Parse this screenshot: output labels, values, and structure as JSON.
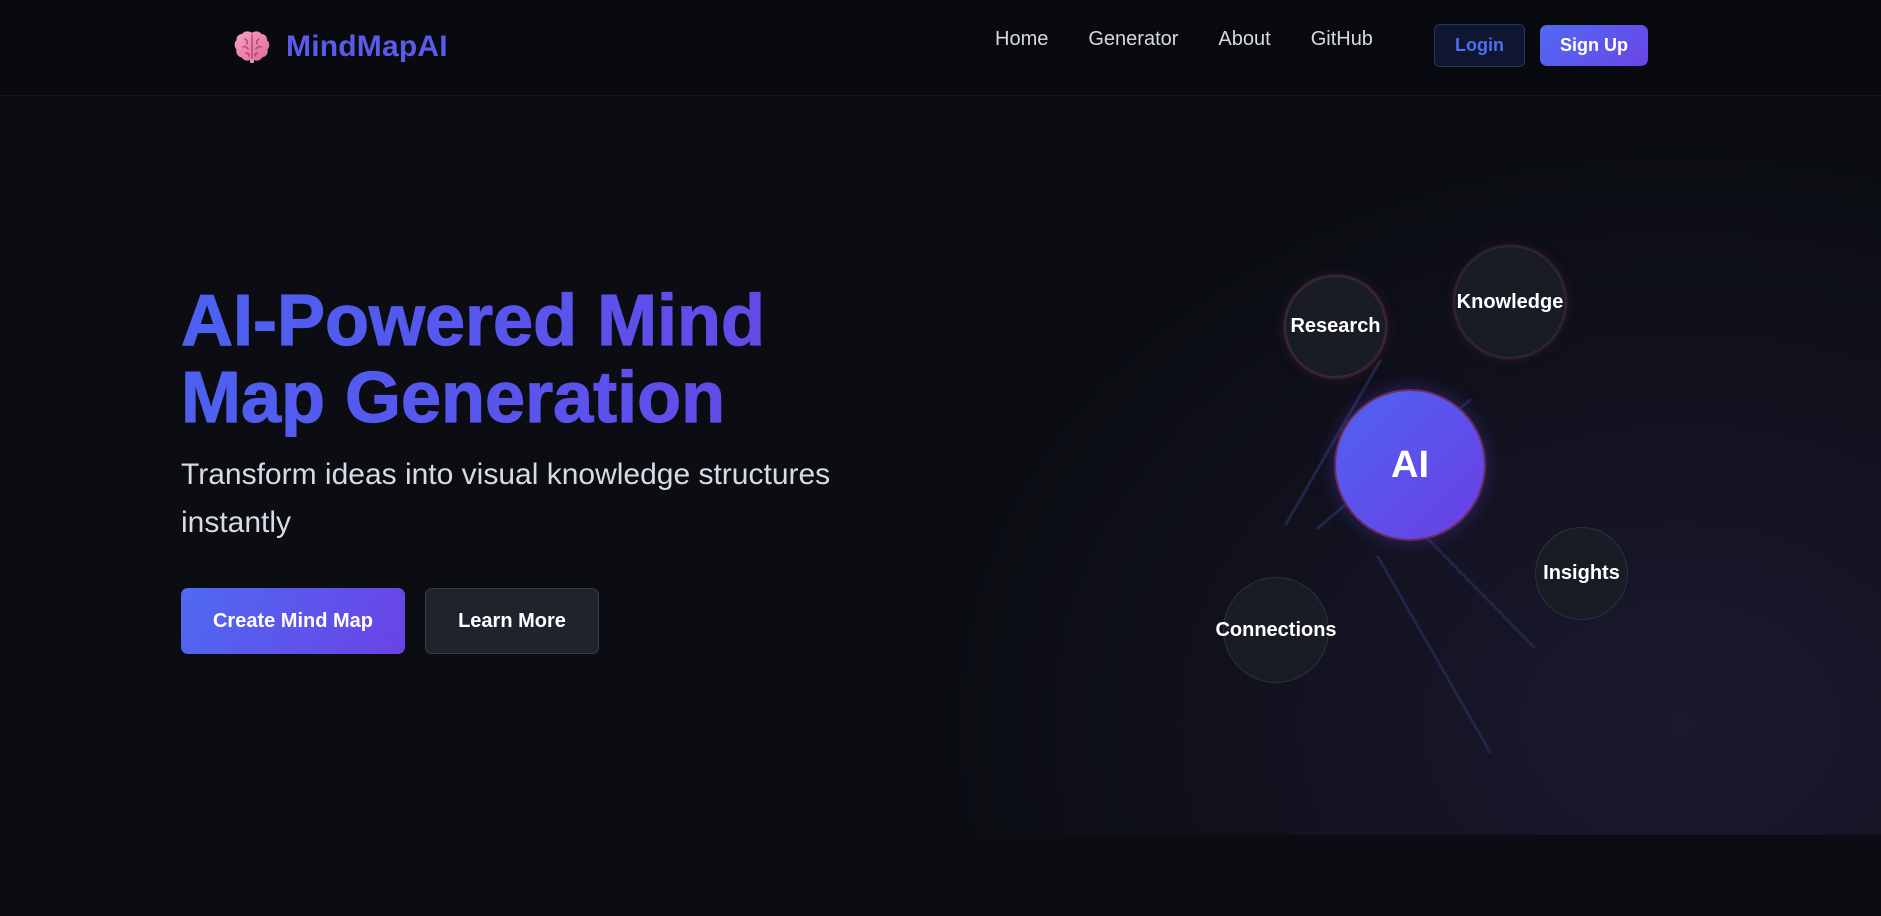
{
  "brand": {
    "name": "MindMapAI",
    "icon": "brain-icon"
  },
  "nav": {
    "links": [
      "Home",
      "Generator",
      "About",
      "GitHub"
    ],
    "login_label": "Login",
    "signup_label": "Sign Up"
  },
  "hero": {
    "title_line1": "AI-Powered Mind",
    "title_line2": "Map Generation",
    "subtitle": "Transform ideas into visual knowledge structures instantly",
    "primary_cta": "Create Mind Map",
    "secondary_cta": "Learn More"
  },
  "mind_map": {
    "center": "AI",
    "nodes": [
      "Research",
      "Knowledge",
      "Insights",
      "Connections"
    ]
  },
  "colors": {
    "accent": "#5b5bea",
    "gradient_start": "#4f6af2",
    "gradient_end": "#6a42e6",
    "background": "#0b0d13"
  }
}
